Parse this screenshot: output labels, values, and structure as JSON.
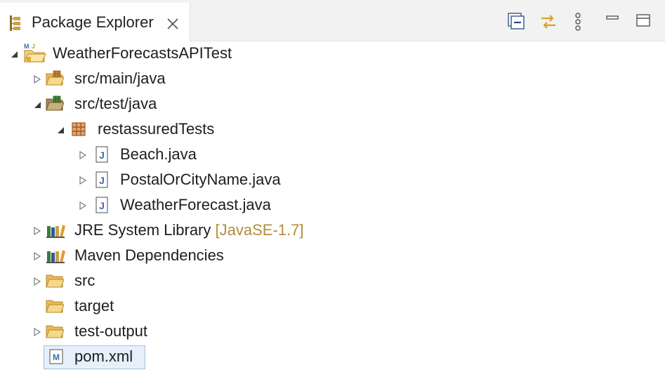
{
  "view": {
    "title": "Package Explorer",
    "toolbar": [
      {
        "name": "collapse-all-icon"
      },
      {
        "name": "link-with-editor-icon"
      },
      {
        "name": "view-menu-icon"
      },
      {
        "name": "minimize-icon"
      },
      {
        "name": "maximize-icon"
      }
    ]
  },
  "tree": {
    "project": {
      "label": "WeatherForecastsAPITest",
      "expanded": true,
      "icon": "maven-project-icon"
    },
    "src_main": {
      "label": "src/main/java",
      "expanded": false,
      "icon": "source-folder-icon"
    },
    "src_test": {
      "label": "src/test/java",
      "expanded": true,
      "icon": "source-folder-icon"
    },
    "package": {
      "label": "restassuredTests",
      "expanded": true,
      "icon": "package-icon"
    },
    "file_beach": {
      "label": "Beach.java",
      "icon": "java-file-icon"
    },
    "file_postal": {
      "label": "PostalOrCityName.java",
      "icon": "java-file-icon"
    },
    "file_weather": {
      "label": "WeatherForecast.java",
      "icon": "java-file-icon"
    },
    "jre": {
      "label": "JRE System Library",
      "decoration": "[JavaSE-1.7]",
      "icon": "library-icon"
    },
    "maven_deps": {
      "label": "Maven Dependencies",
      "icon": "library-icon"
    },
    "src": {
      "label": "src",
      "icon": "folder-icon"
    },
    "target": {
      "label": "target",
      "icon": "folder-icon"
    },
    "test_output": {
      "label": "test-output",
      "icon": "folder-icon"
    },
    "pom": {
      "label": "pom.xml",
      "icon": "maven-pom-icon",
      "selected": true
    }
  },
  "colors": {
    "folder": "#e8b955",
    "java": "#3a6fb0",
    "library_book": "#3c7a3c",
    "decoration": "#b48c3c",
    "selection": "#e6f0fa"
  }
}
